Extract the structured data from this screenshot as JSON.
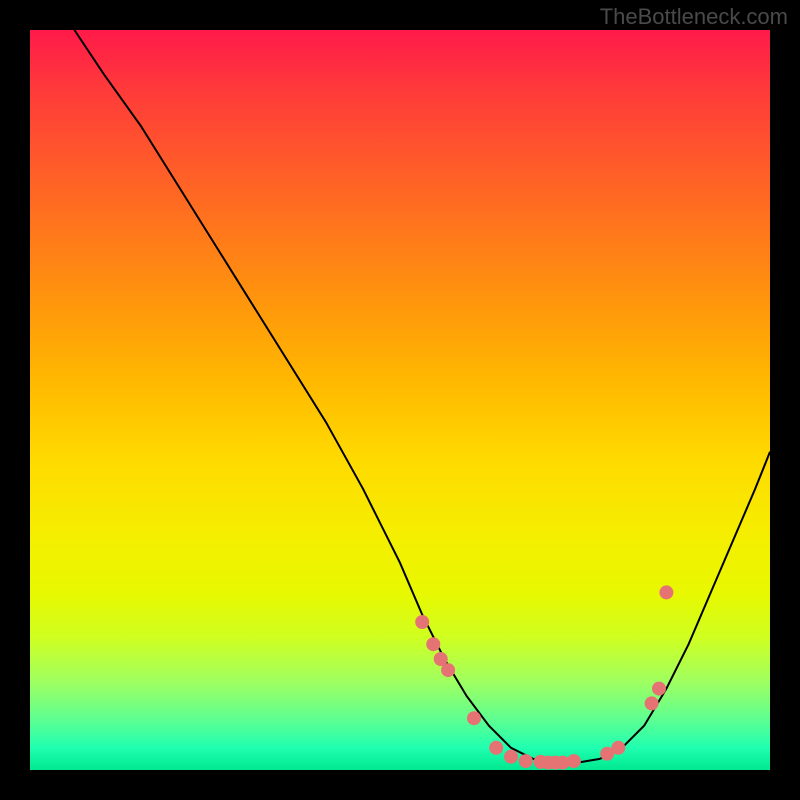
{
  "watermark": "TheBottleneck.com",
  "chart_data": {
    "type": "line",
    "title": "",
    "xlabel": "",
    "ylabel": "",
    "xlim": [
      0,
      100
    ],
    "ylim": [
      0,
      100
    ],
    "series": [
      {
        "name": "curve",
        "x": [
          6,
          10,
          15,
          20,
          25,
          30,
          35,
          40,
          45,
          50,
          53,
          56,
          59,
          62,
          65,
          68,
          71,
          74,
          77,
          80,
          83,
          86,
          89,
          92,
          95,
          98,
          100
        ],
        "y": [
          100,
          94,
          87,
          79,
          71,
          63,
          55,
          47,
          38,
          28,
          21,
          15,
          10,
          6,
          3,
          1.5,
          1,
          1,
          1.5,
          3,
          6,
          11,
          17,
          24,
          31,
          38,
          43
        ]
      }
    ],
    "points": {
      "name": "highlights",
      "x": [
        53,
        54.5,
        55.5,
        56.5,
        60,
        63,
        65,
        67,
        69,
        70,
        71,
        72,
        73.5,
        78,
        79.5,
        84,
        85,
        86
      ],
      "y": [
        20,
        17,
        15,
        13.5,
        7,
        3,
        1.8,
        1.2,
        1.1,
        1,
        1,
        1,
        1.2,
        2.2,
        3,
        9,
        11,
        24
      ]
    },
    "colors": {
      "curve": "#000000",
      "points": "#e57373"
    }
  }
}
